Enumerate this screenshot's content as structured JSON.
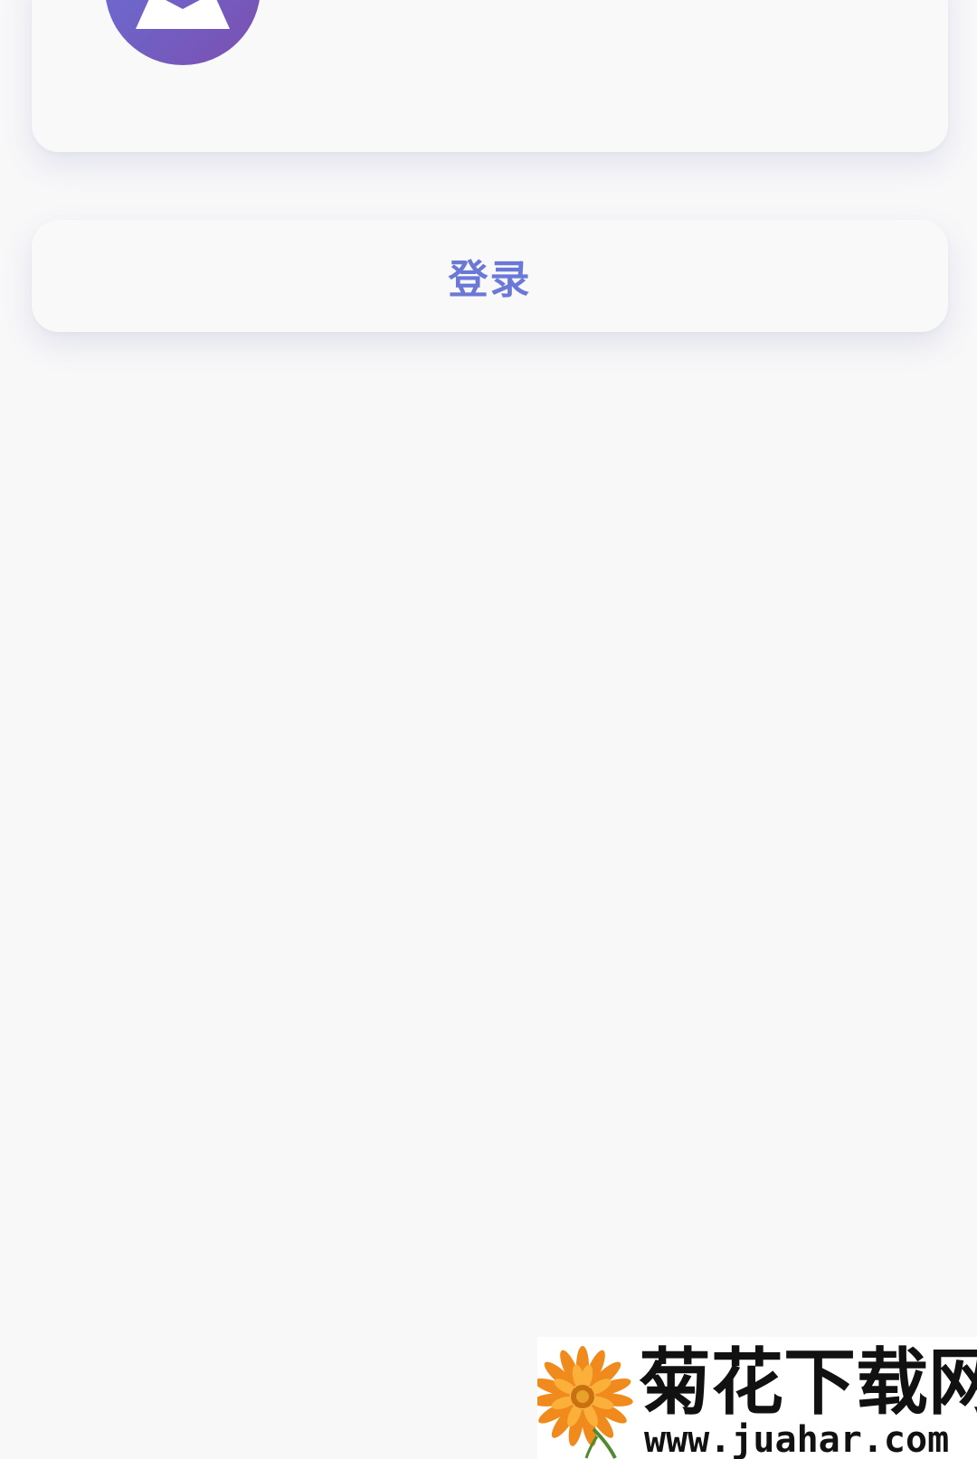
{
  "profile": {
    "avatar_icon": "user-avatar-icon"
  },
  "login": {
    "label": "登录"
  },
  "watermark": {
    "title": "菊花下载网",
    "url": "www.juahar.com",
    "logo_icon": "flower-logo"
  },
  "colors": {
    "background": "#f8f8f9",
    "card": "#f9f9fa",
    "accent": "#6a78d6",
    "avatar_gradient_start": "#6772d8",
    "avatar_gradient_end": "#7b4fb0"
  }
}
